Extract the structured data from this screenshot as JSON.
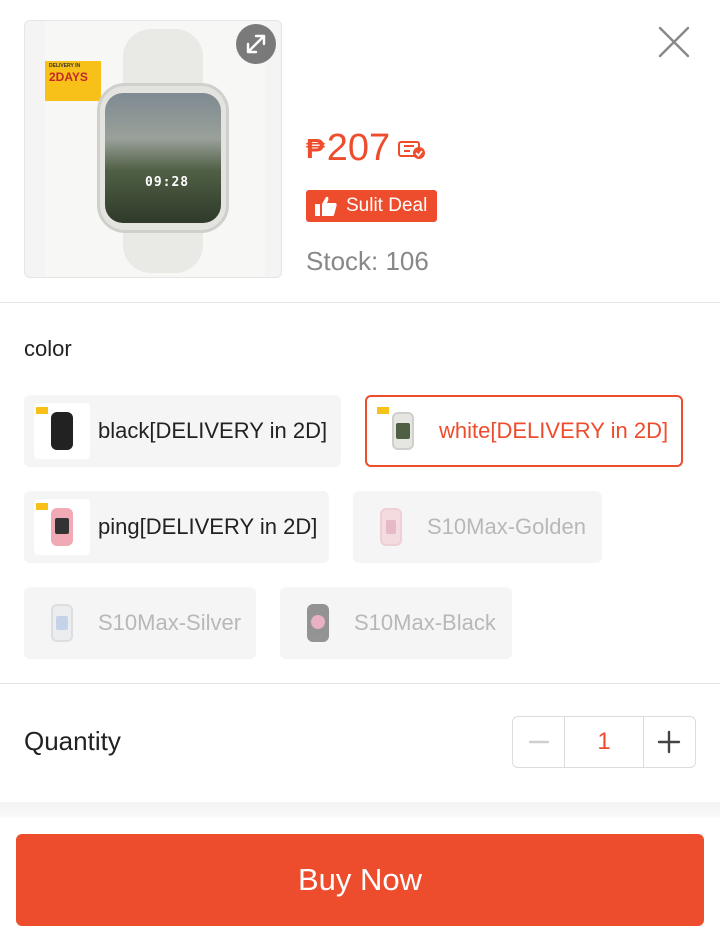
{
  "product": {
    "image_badge_small": "DELIVERY IN",
    "image_badge": "2DAYS",
    "watch_time": "09:28",
    "currency_symbol": "₱",
    "price": "207",
    "deal_label": "Sulit Deal",
    "stock_text": "Stock: 106"
  },
  "variation": {
    "label": "color",
    "options": [
      {
        "label": "black[DELIVERY in 2D]",
        "state": "available"
      },
      {
        "label": "white[DELIVERY in 2D]",
        "state": "selected"
      },
      {
        "label": "ping[DELIVERY in 2D]",
        "state": "available"
      },
      {
        "label": "S10Max-Golden",
        "state": "disabled"
      },
      {
        "label": "S10Max-Silver",
        "state": "disabled"
      },
      {
        "label": "S10Max-Black",
        "state": "disabled"
      }
    ]
  },
  "quantity": {
    "label": "Quantity",
    "value": "1",
    "minus_icon": "minus-icon",
    "plus_icon": "plus-icon"
  },
  "buy_button": {
    "label": "Buy Now"
  },
  "colors": {
    "accent": "#ee4d2d",
    "disabled_text": "#b8b8b8",
    "option_bg": "#f5f5f5"
  },
  "icons": [
    "expand-icon",
    "close-icon",
    "voucher-icon",
    "thumbs-up-icon"
  ]
}
